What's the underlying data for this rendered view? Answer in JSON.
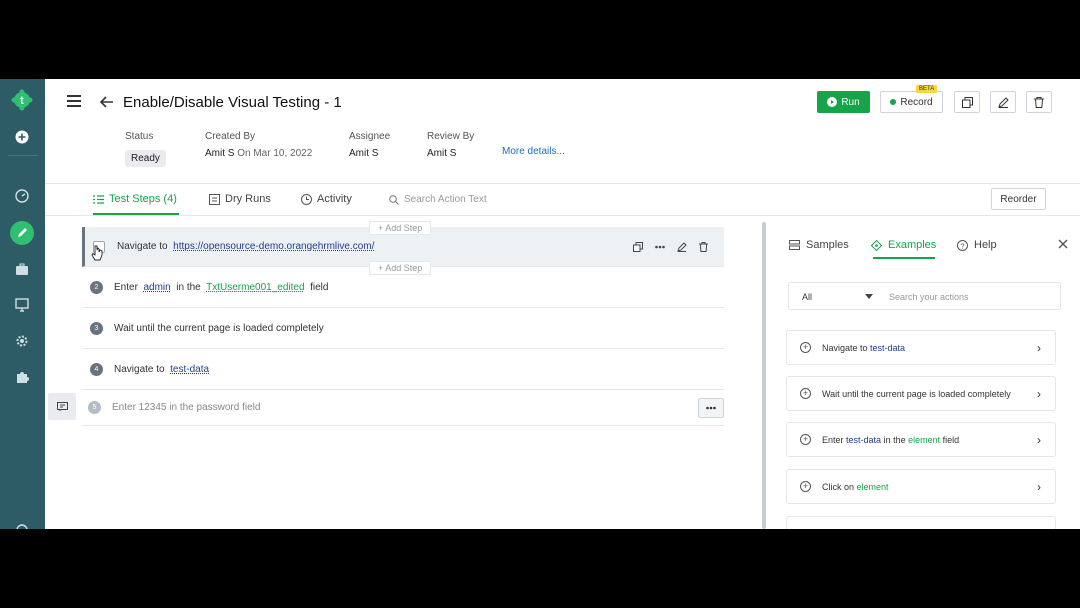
{
  "header": {
    "title": "Enable/Disable Visual Testing - 1",
    "run_label": "Run",
    "record_label": "Record",
    "beta_label": "BETA",
    "more_details": "More details..."
  },
  "meta": {
    "status_label": "Status",
    "status_value": "Ready",
    "created_label": "Created By",
    "created_by": "Amit S",
    "created_on": "On Mar 10, 2022",
    "assignee_label": "Assignee",
    "assignee": "Amit S",
    "review_label": "Review By",
    "reviewer": "Amit S"
  },
  "tabs": {
    "steps": "Test Steps (4)",
    "dry_runs": "Dry Runs",
    "activity": "Activity",
    "search_placeholder": "Search Action Text",
    "reorder": "Reorder"
  },
  "add_step_label": "+ Add Step",
  "steps": [
    {
      "num": "1",
      "prefix": "Navigate to",
      "value": "https://opensource-demo.orangehrmlive.com/"
    },
    {
      "num": "2",
      "prefix": "Enter",
      "value": "admin",
      "mid": "in the",
      "element": "TxtUserme001_edited",
      "suffix": "field"
    },
    {
      "num": "3",
      "text": "Wait until the current page is loaded completely"
    },
    {
      "num": "4",
      "prefix": "Navigate to",
      "value": "test-data"
    },
    {
      "num": "5",
      "placeholder": "Enter 12345 in the password field"
    }
  ],
  "right_panel": {
    "tabs": [
      "Samples",
      "Examples",
      "Help"
    ],
    "filter_value": "All",
    "search_placeholder": "Search your actions",
    "cards": [
      {
        "prefix": "Navigate to",
        "value": "test-data"
      },
      {
        "text": "Wait until the current page is loaded completely"
      },
      {
        "prefix": "Enter",
        "value": "test-data",
        "mid": "in the",
        "element": "element",
        "suffix": "field"
      },
      {
        "prefix": "Click on",
        "element": "element"
      }
    ]
  },
  "colors": {
    "sidebar": "#2d5b66",
    "accent": "#16a34a",
    "link": "#1f3d8f"
  }
}
